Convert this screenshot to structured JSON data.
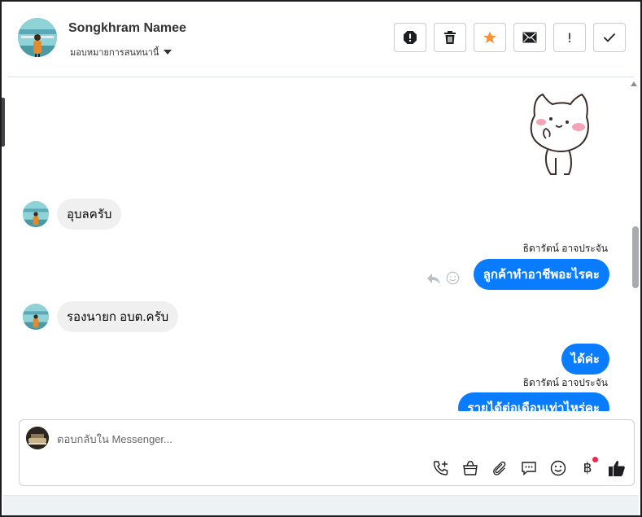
{
  "header": {
    "contact_name": "Songkhram Namee",
    "assign_label": "มอบหมายการสนทนานี้",
    "toolbar": [
      {
        "name": "report-button",
        "icon": "alert-octagon-icon"
      },
      {
        "name": "delete-button",
        "icon": "trash-icon"
      },
      {
        "name": "star-button",
        "icon": "star-icon",
        "color": "#f7923a"
      },
      {
        "name": "mark-unread-button",
        "icon": "envelope-icon"
      },
      {
        "name": "follow-up-button",
        "icon": "exclamation-icon",
        "glyph": "!"
      },
      {
        "name": "mark-done-button",
        "icon": "check-icon"
      }
    ]
  },
  "messages": [
    {
      "direction": "in",
      "text": "อุบลครับ"
    },
    {
      "direction": "out",
      "sender": "ธิดารัตน์ อาจประจัน",
      "text": "ลูกค้าทำอาชีพอะไรคะ"
    },
    {
      "direction": "in",
      "text": "รองนายก อบต.ครับ"
    },
    {
      "direction": "out",
      "text": "ได้ค่ะ"
    },
    {
      "direction": "out",
      "sender": "ธิดารัตน์ อาจประจัน",
      "text": "รายได้ต่อเดือนเท่าไหร่คะ"
    }
  ],
  "composer": {
    "placeholder": "ตอบกลับใน Messenger...",
    "icons": [
      "call-plus-icon",
      "shopping-bag-icon",
      "paperclip-icon",
      "saved-reply-icon",
      "emoji-icon",
      "baht-icon",
      "thumbs-up-icon"
    ],
    "baht_glyph": "฿"
  },
  "colors": {
    "outgoing_bubble": "#0a7cff",
    "incoming_bubble": "#f0f0f0",
    "notification_dot": "#f02849"
  }
}
